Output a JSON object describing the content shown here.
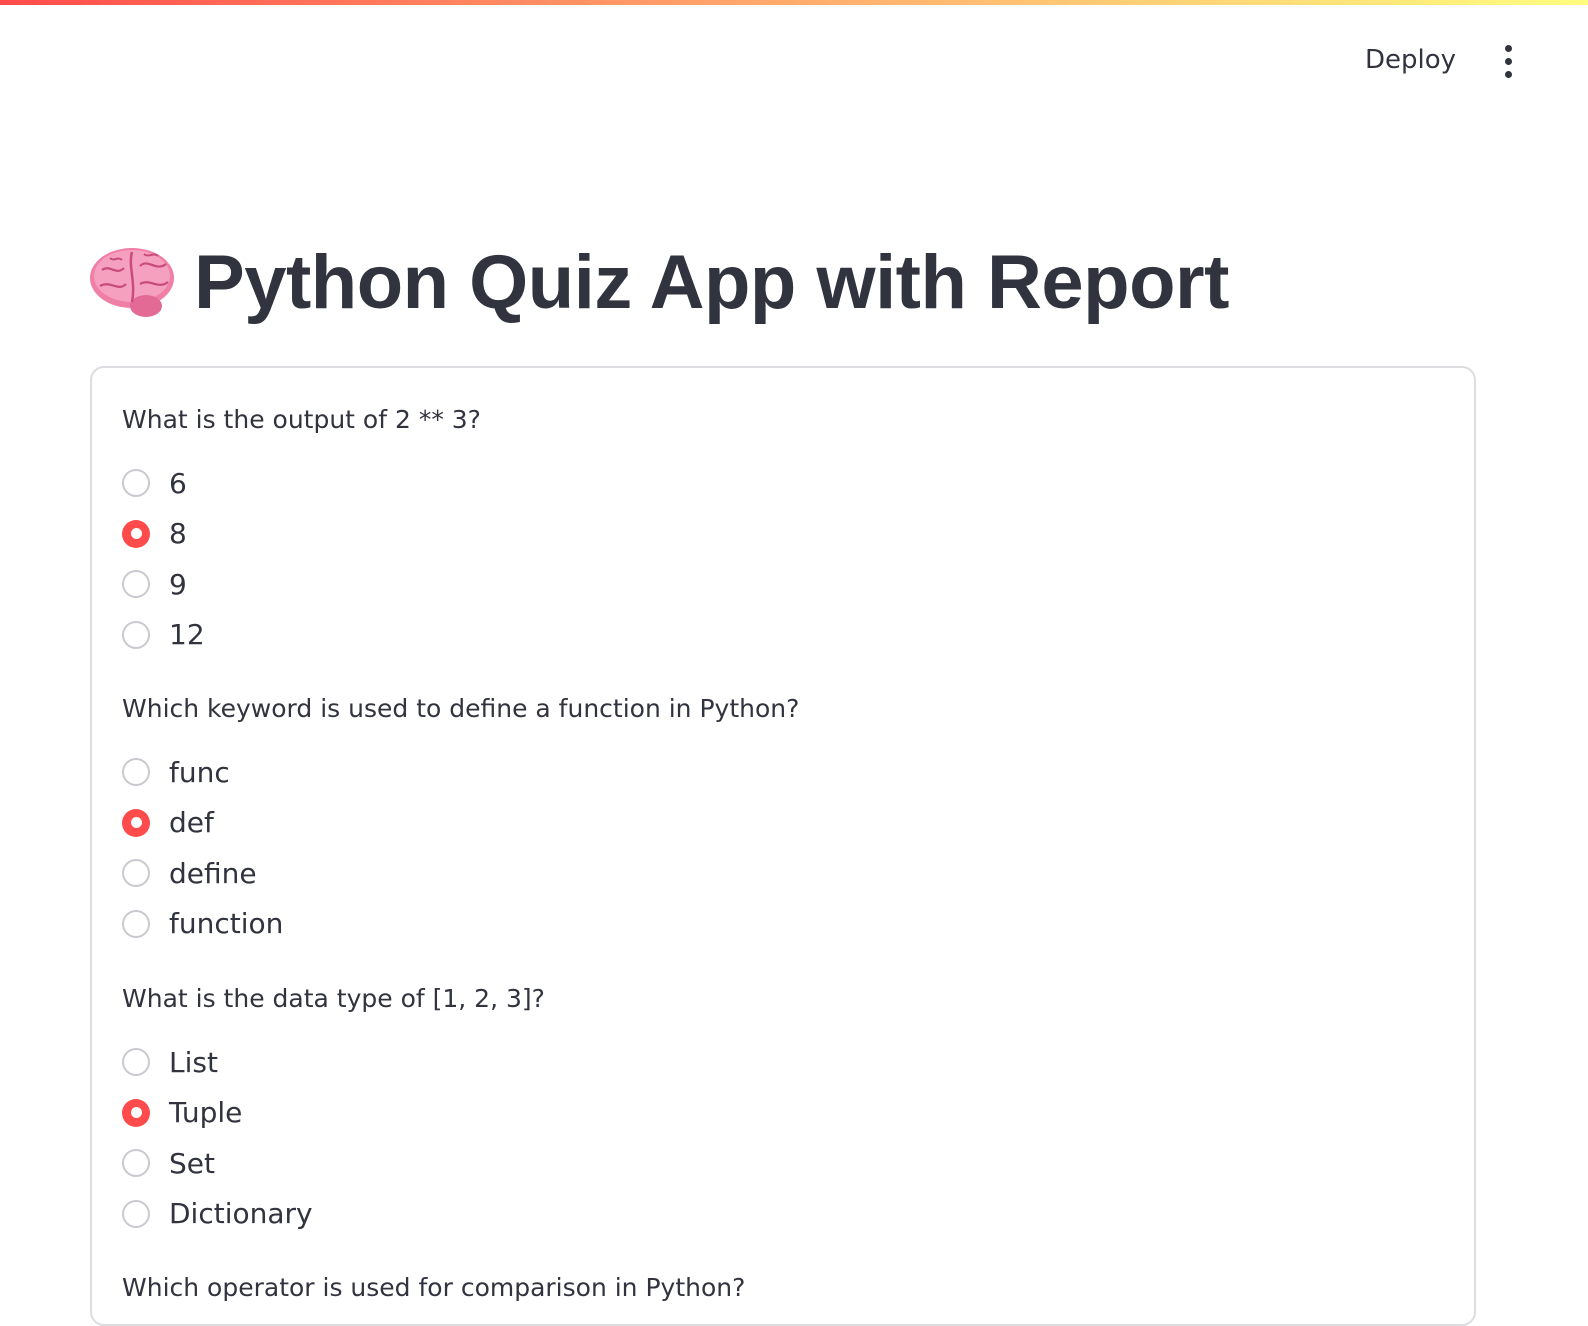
{
  "header": {
    "deploy_label": "Deploy",
    "menu_icon": "kebab-menu-icon"
  },
  "page": {
    "title_icon": "brain-emoji",
    "title": "Python Quiz App with Report"
  },
  "colors": {
    "accent": "#ff4b4b",
    "text": "#31333f",
    "border": "#dcdde1"
  },
  "quiz": {
    "questions": [
      {
        "label": "What is the output of 2 ** 3?",
        "options": [
          "6",
          "8",
          "9",
          "12"
        ],
        "selected": "8"
      },
      {
        "label": "Which keyword is used to define a function in Python?",
        "options": [
          "func",
          "def",
          "define",
          "function"
        ],
        "selected": "def"
      },
      {
        "label": "What is the data type of [1, 2, 3]?",
        "options": [
          "List",
          "Tuple",
          "Set",
          "Dictionary"
        ],
        "selected": "Tuple"
      },
      {
        "label": "Which operator is used for comparison in Python?"
      }
    ]
  }
}
